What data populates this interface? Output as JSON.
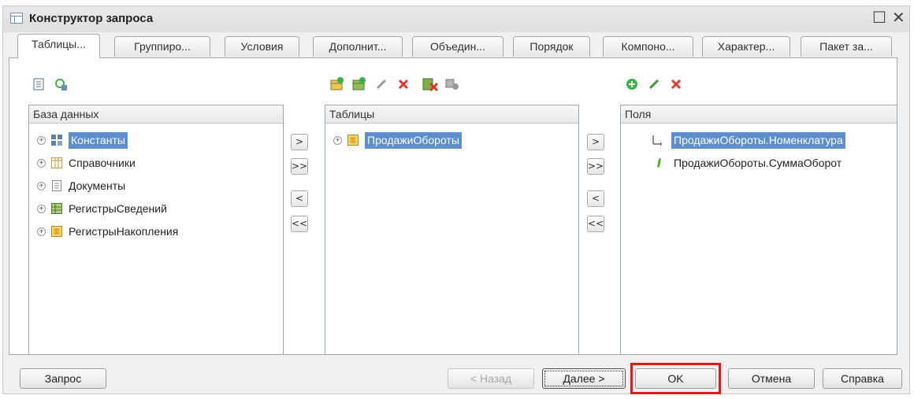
{
  "window": {
    "title": "Конструктор запроса",
    "maximize_glyph": "☐",
    "close_glyph": "✕"
  },
  "tabs": [
    {
      "label": "Таблицы...",
      "active": true
    },
    {
      "label": "Группиро..."
    },
    {
      "label": "Условия"
    },
    {
      "label": "Дополнит..."
    },
    {
      "label": "Объедин..."
    },
    {
      "label": "Порядок"
    },
    {
      "label": "Компоно..."
    },
    {
      "label": "Характер..."
    },
    {
      "label": "Пакет за..."
    }
  ],
  "database": {
    "header": "База данных",
    "items": [
      {
        "label": "Константы",
        "icon": "constants-icon",
        "selected": true
      },
      {
        "label": "Справочники",
        "icon": "catalogs-icon"
      },
      {
        "label": "Документы",
        "icon": "documents-icon"
      },
      {
        "label": "РегистрыСведений",
        "icon": "info-registers-icon"
      },
      {
        "label": "РегистрыНакопления",
        "icon": "accumulation-registers-icon"
      }
    ]
  },
  "tables": {
    "header": "Таблицы",
    "items": [
      {
        "label": "ПродажиОбороты",
        "icon": "accumulation-register-table-icon",
        "selected": true
      }
    ]
  },
  "fields": {
    "header": "Поля",
    "items": [
      {
        "label": "ПродажиОбороты.Номенклатура",
        "icon": "dimension-field-icon",
        "selected": true
      },
      {
        "label": "ПродажиОбороты.СуммаОборот",
        "icon": "resource-field-icon"
      }
    ]
  },
  "arrows": {
    "move_right": ">",
    "move_all_right": ">>",
    "move_left": "<",
    "move_all_left": "<<"
  },
  "buttons": {
    "query": "Запрос",
    "back": "< Назад",
    "next": "Далее >",
    "ok": "OK",
    "cancel": "Отмена",
    "help": "Справка"
  },
  "colors": {
    "selection": "#5c8ed0",
    "highlight_frame": "#e21a1a",
    "green_add": "#3bb34a",
    "red_delete": "#e0382c"
  }
}
